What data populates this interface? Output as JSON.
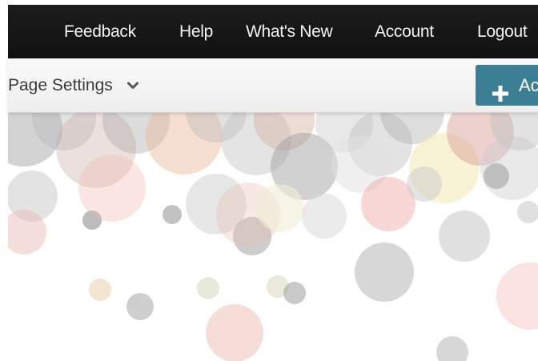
{
  "topnav": {
    "items": [
      {
        "label": "Feedback"
      },
      {
        "label": "Help"
      },
      {
        "label": "What's New"
      },
      {
        "label": "Account"
      },
      {
        "label": "Logout"
      }
    ]
  },
  "subbar": {
    "page_settings_label": "Page Settings",
    "add_button_label": "Ac"
  },
  "colors": {
    "topbar_bg": "#151515",
    "add_button_bg": "#3c7f95"
  },
  "icons": [
    "chevron-down-icon",
    "plus-icon"
  ]
}
